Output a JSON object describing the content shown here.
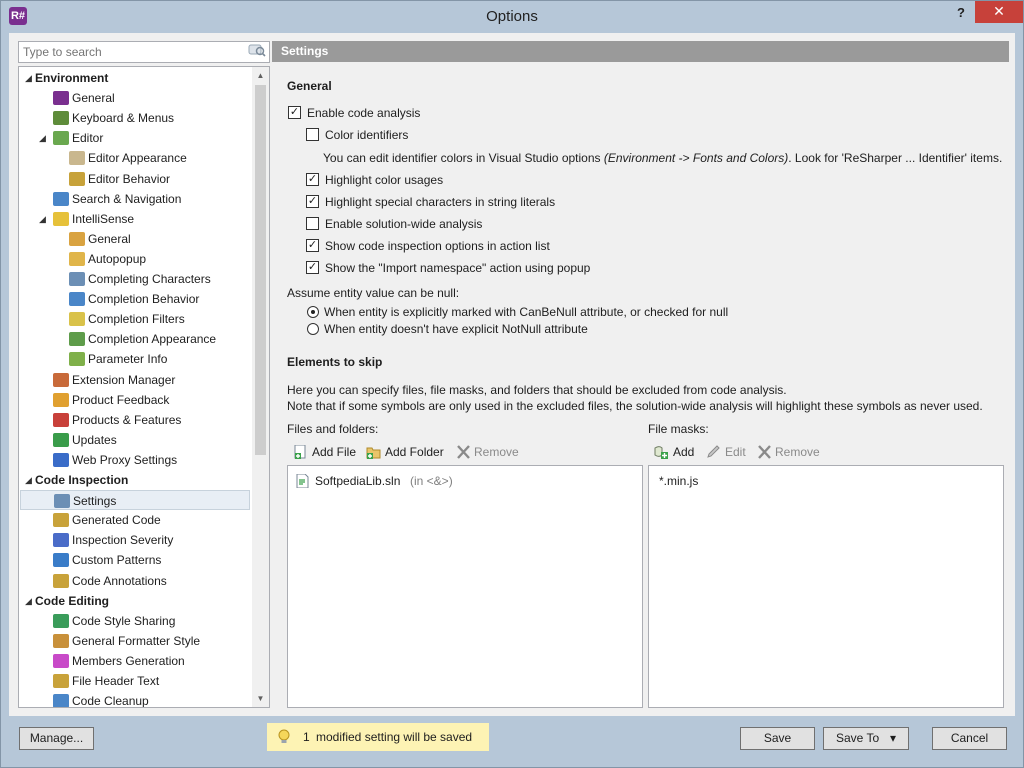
{
  "window": {
    "title": "Options",
    "help_label": "?",
    "close_label": "✕",
    "app_icon_text": "R#"
  },
  "search": {
    "placeholder": "Type to search"
  },
  "tree": {
    "items": [
      {
        "label": "Environment",
        "level": 0,
        "header": true,
        "expanded": true
      },
      {
        "label": "General",
        "level": 1,
        "icon": "resharper-icon",
        "color": "#7a2f8f"
      },
      {
        "label": "Keyboard & Menus",
        "level": 1,
        "icon": "keyboard-icon",
        "color": "#5e8c3a"
      },
      {
        "label": "Editor",
        "level": 1,
        "icon": "pencil-icon",
        "color": "#6aa84f",
        "expanded": true
      },
      {
        "label": "Editor Appearance",
        "level": 2,
        "icon": "palette-icon",
        "color": "#c9b78e"
      },
      {
        "label": "Editor Behavior",
        "level": 2,
        "icon": "gear-icon",
        "color": "#c7a23a"
      },
      {
        "label": "Search & Navigation",
        "level": 1,
        "icon": "magnifier-icon",
        "color": "#4a86c8"
      },
      {
        "label": "IntelliSense",
        "level": 1,
        "icon": "lightbulb-icon",
        "color": "#e6c13a",
        "expanded": true
      },
      {
        "label": "General",
        "level": 2,
        "icon": "intellisense-general-icon",
        "color": "#d9a341"
      },
      {
        "label": "Autopopup",
        "level": 2,
        "icon": "autopopup-icon",
        "color": "#e0b54a"
      },
      {
        "label": "Completing Characters",
        "level": 2,
        "icon": "characters-icon",
        "color": "#6c8fb5"
      },
      {
        "label": "Completion Behavior",
        "level": 2,
        "icon": "completion-behavior-icon",
        "color": "#4a86c8"
      },
      {
        "label": "Completion Filters",
        "level": 2,
        "icon": "filter-icon",
        "color": "#d9c24a"
      },
      {
        "label": "Completion Appearance",
        "level": 2,
        "icon": "completion-appearance-icon",
        "color": "#5e9c4a"
      },
      {
        "label": "Parameter Info",
        "level": 2,
        "icon": "parameter-info-icon",
        "color": "#7fb04a"
      },
      {
        "label": "Extension Manager",
        "level": 1,
        "icon": "extension-icon",
        "color": "#c86a3a"
      },
      {
        "label": "Product Feedback",
        "level": 1,
        "icon": "envelope-icon",
        "color": "#e0a030"
      },
      {
        "label": "Products & Features",
        "level": 1,
        "icon": "products-icon",
        "color": "#c8403a"
      },
      {
        "label": "Updates",
        "level": 1,
        "icon": "updates-icon",
        "color": "#3a9c4a"
      },
      {
        "label": "Web Proxy Settings",
        "level": 1,
        "icon": "globe-icon",
        "color": "#3a6cc8"
      },
      {
        "label": "Code Inspection",
        "level": 0,
        "header": true,
        "expanded": true
      },
      {
        "label": "Settings",
        "level": 1,
        "icon": "settings-icon",
        "color": "#6c8fb5",
        "selected": true
      },
      {
        "label": "Generated Code",
        "level": 1,
        "icon": "generated-code-icon",
        "color": "#c8a23a"
      },
      {
        "label": "Inspection Severity",
        "level": 1,
        "icon": "severity-icon",
        "color": "#4a6cc8"
      },
      {
        "label": "Custom Patterns",
        "level": 1,
        "icon": "patterns-icon",
        "color": "#3a7cc8"
      },
      {
        "label": "Code Annotations",
        "level": 1,
        "icon": "annotations-icon",
        "color": "#c8a23a"
      },
      {
        "label": "Code Editing",
        "level": 0,
        "header": true,
        "expanded": true
      },
      {
        "label": "Code Style Sharing",
        "level": 1,
        "icon": "style-sharing-icon",
        "color": "#3a9c5a"
      },
      {
        "label": "General Formatter Style",
        "level": 1,
        "icon": "formatter-icon",
        "color": "#c8903a"
      },
      {
        "label": "Members Generation",
        "level": 1,
        "icon": "members-icon",
        "color": "#c84ac8"
      },
      {
        "label": "File Header Text",
        "level": 1,
        "icon": "file-header-icon",
        "color": "#c8a23a"
      },
      {
        "label": "Code Cleanup",
        "level": 1,
        "icon": "broom-icon",
        "color": "#4a86c8"
      }
    ]
  },
  "panel": {
    "header": "Settings",
    "general": {
      "title": "General",
      "enable_code_analysis": "Enable code analysis",
      "color_identifiers": "Color identifiers",
      "identifier_note_1": "You can edit identifier colors in Visual Studio options ",
      "identifier_note_2": "(Environment -> Fonts and Colors)",
      "identifier_note_3": ". Look for 'ReSharper ... Identifier' items.",
      "highlight_color_usages": "Highlight color usages",
      "highlight_special_chars": "Highlight special characters in string literals",
      "enable_solution_wide": "Enable solution-wide analysis",
      "show_code_inspection_options": "Show code inspection options in action list",
      "show_import_namespace": "Show the \"Import namespace\" action using popup",
      "assume_null_label": "Assume entity value can be null:",
      "radio_marked": "When entity is explicitly marked with CanBeNull attribute, or checked for null",
      "radio_no_notnull": "When entity doesn't have explicit NotNull attribute"
    },
    "checkbox_states": {
      "enable_code_analysis": true,
      "color_identifiers": false,
      "highlight_color_usages": true,
      "highlight_special_chars": true,
      "enable_solution_wide": false,
      "show_code_inspection_options": true,
      "show_import_namespace": true
    },
    "radio_selected": "marked",
    "skip": {
      "title": "Elements to skip",
      "desc_1": "Here you can specify files, file masks, and folders that should be excluded from code analysis.",
      "desc_2": "Note that if some symbols are only used in the excluded files, the solution-wide analysis will highlight these symbols as never used.",
      "files_label": "Files and folders:",
      "masks_label": "File masks:",
      "add_file": "Add File",
      "add_folder": "Add Folder",
      "remove": "Remove",
      "add": "Add",
      "edit": "Edit",
      "remove_mask": "Remove",
      "files": [
        {
          "name": "SoftpediaLib.sln",
          "suffix": " (in <&>)"
        }
      ],
      "masks": [
        "*.min.js"
      ]
    }
  },
  "footer": {
    "manage": "Manage...",
    "note_count": "1",
    "note_text": "modified setting will be saved",
    "save": "Save",
    "save_to": "Save To",
    "save_to_arrow": "▾",
    "cancel": "Cancel"
  }
}
